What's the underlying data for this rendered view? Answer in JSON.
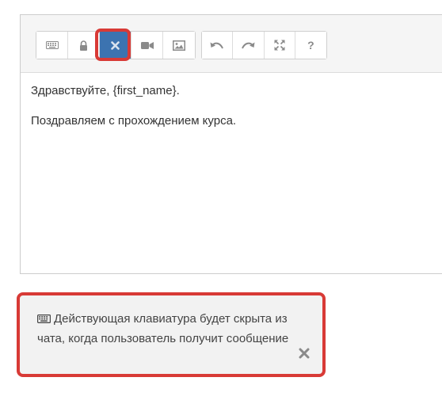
{
  "editor": {
    "toolbar": {
      "group1": [
        {
          "name": "keyboard-button",
          "icon": "keyboard-icon"
        },
        {
          "name": "lock-button",
          "icon": "lock-icon"
        },
        {
          "name": "remove-keyboard-button",
          "icon": "close-icon",
          "active": true
        },
        {
          "name": "video-button",
          "icon": "video-camera-icon"
        },
        {
          "name": "image-button",
          "icon": "image-icon"
        }
      ],
      "group2": [
        {
          "name": "undo-button",
          "icon": "undo-icon"
        },
        {
          "name": "redo-button",
          "icon": "redo-icon"
        },
        {
          "name": "fullscreen-button",
          "icon": "expand-icon"
        },
        {
          "name": "help-button",
          "icon": "question-icon",
          "label": "?"
        }
      ]
    },
    "content": {
      "line1": "Здравствуйте, {first_name}.",
      "line2": "Поздравляем с прохождением курса."
    }
  },
  "notice": {
    "text": "Действующая клавиатура будет скрыта из чата, когда пользователь получит сообщение",
    "icon": "keyboard-icon"
  },
  "colors": {
    "accent": "#3c73b0",
    "highlight": "#d83a36",
    "icon_gray": "#888888"
  }
}
